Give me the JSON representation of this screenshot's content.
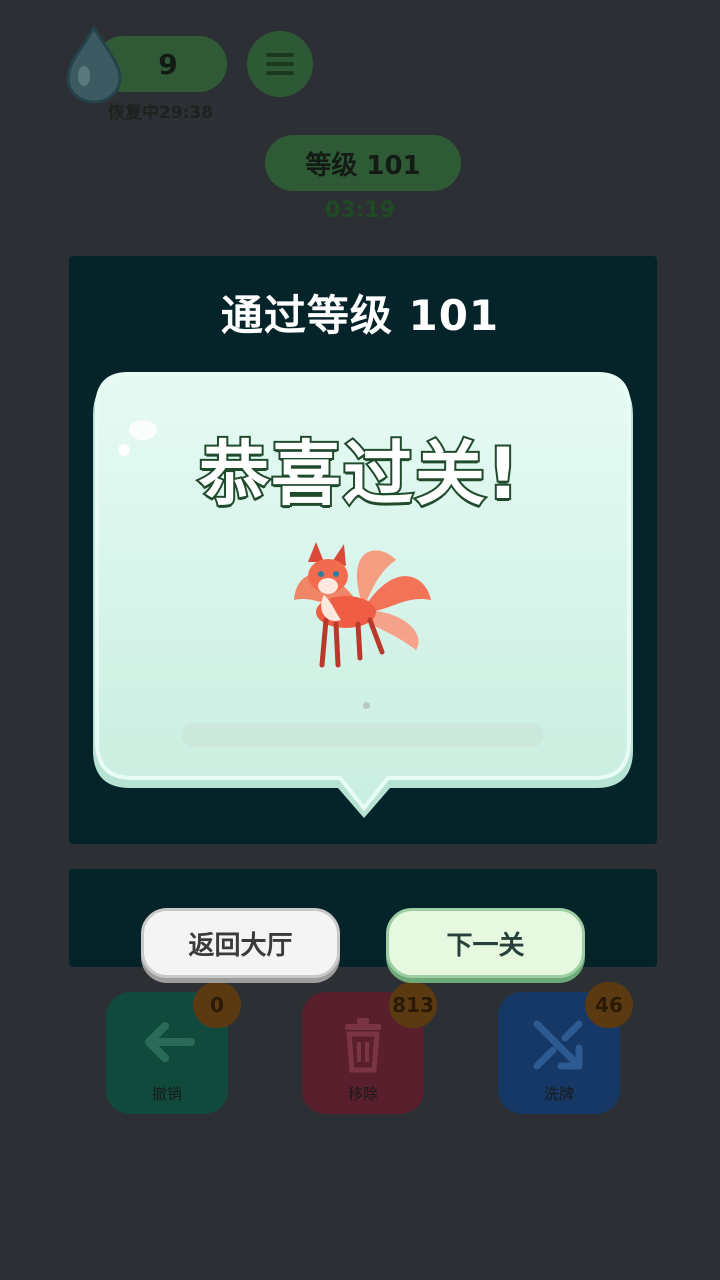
{
  "top_bar": {
    "energy_count": "9",
    "recover_text": "恢复中29:38",
    "level_label": "等级 101",
    "timer": "03:19"
  },
  "result_panel": {
    "title": "通过等级 101",
    "congrats": "恭喜过关!",
    "progress": 0
  },
  "buttons": {
    "back_to_lobby": "返回大厅",
    "next_level": "下一关"
  },
  "tools": [
    {
      "label": "撤销",
      "count": "0",
      "color": "#0f4a3d"
    },
    {
      "label": "移除",
      "count": "813",
      "color": "#5a1f2c"
    },
    {
      "label": "洗牌",
      "count": "46",
      "color": "#163866"
    }
  ],
  "icons": [
    "water-drop-icon",
    "menu-icon",
    "fox-icon",
    "undo-arrow-icon",
    "trash-icon",
    "shuffle-icon"
  ]
}
